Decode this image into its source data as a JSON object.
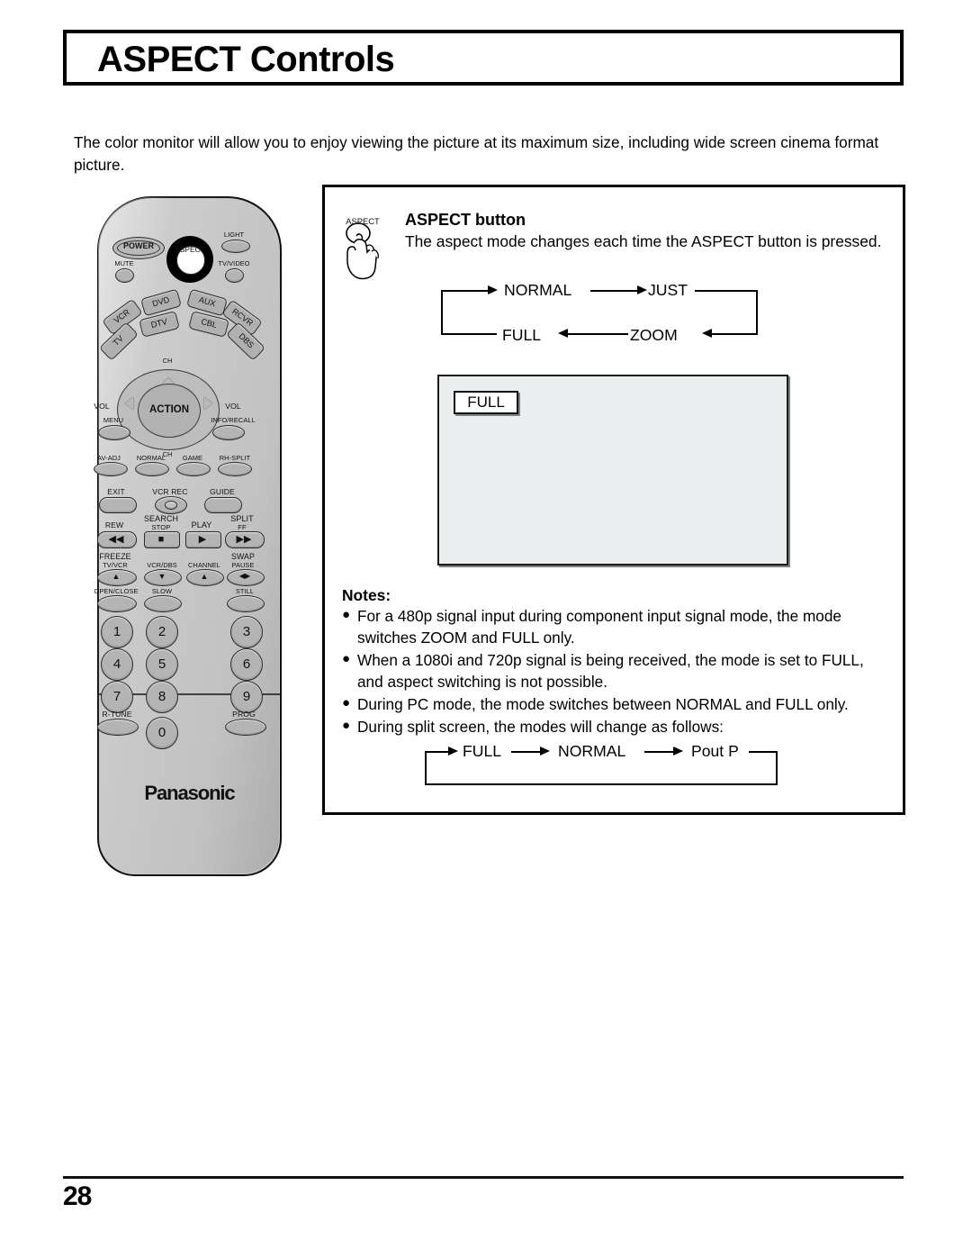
{
  "document": {
    "title": "ASPECT Controls",
    "intro": "The color monitor will allow you to enjoy viewing the picture at its maximum size, including wide screen cinema format picture.",
    "page_number": "28"
  },
  "panel": {
    "hand_icon_caption": "ASPECT",
    "section_title": "ASPECT button",
    "section_body": "The aspect mode changes each time the ASPECT button is pressed.",
    "aspect_cycle": {
      "top_left": "NORMAL",
      "top_right": "JUST",
      "bottom_right": "ZOOM",
      "bottom_left": "FULL"
    },
    "screen_preview": {
      "osd_label": "FULL"
    },
    "notes_heading": "Notes:",
    "notes": [
      "For a 480p signal input during component input signal mode, the mode switches ZOOM and FULL only.",
      "When a 1080i and 720p signal is being received, the mode is set to FULL, and aspect switching is not possible.",
      "During PC mode, the mode switches between NORMAL and FULL only.",
      "During split screen, the modes will change as follows:"
    ],
    "split_cycle": {
      "first": "FULL",
      "second": "NORMAL",
      "third": "Pout P"
    }
  },
  "remote": {
    "brand": "Panasonic",
    "power_label": "POWER",
    "aspect_label": "ASPECT",
    "top_labels": {
      "light": "LIGHT",
      "mute": "MUTE",
      "tv_video": "TV/VIDEO"
    },
    "device_buttons": [
      "VCR",
      "DVD",
      "AUX",
      "RCVR",
      "DTV",
      "CBL",
      "TV",
      "DBS"
    ],
    "dpad": {
      "center": "ACTION",
      "left": "VOL",
      "right": "VOL",
      "top": "CH",
      "bottom": "CH"
    },
    "menu_label": "MENU",
    "info_label": "INFO/RECALL",
    "function_row": [
      "AV-ADJ",
      "NORMAL",
      "GAME",
      "RH-SPLIT"
    ],
    "exit_row": {
      "exit": "EXIT",
      "vcr_rec": "VCR REC",
      "guide": "GUIDE"
    },
    "transport_row": {
      "rew": "REW",
      "search": "SEARCH",
      "stop": "STOP",
      "play": "PLAY",
      "split": "SPLIT",
      "ff": "FF"
    },
    "mode_row": {
      "freeze": "FREEZE",
      "tv_vcr": "TV/VCR",
      "vcr_dbs": "VCR/DBS",
      "channel": "CHANNEL",
      "swap": "SWAP",
      "pause": "PAUSE",
      "open_close": "OPEN/CLOSE",
      "slow": "SLOW",
      "still": "STILL"
    },
    "keypad": [
      "1",
      "2",
      "3",
      "4",
      "5",
      "6",
      "7",
      "8",
      "9",
      "0"
    ],
    "r_tune_label": "R-TUNE",
    "prog_label": "PROG"
  }
}
